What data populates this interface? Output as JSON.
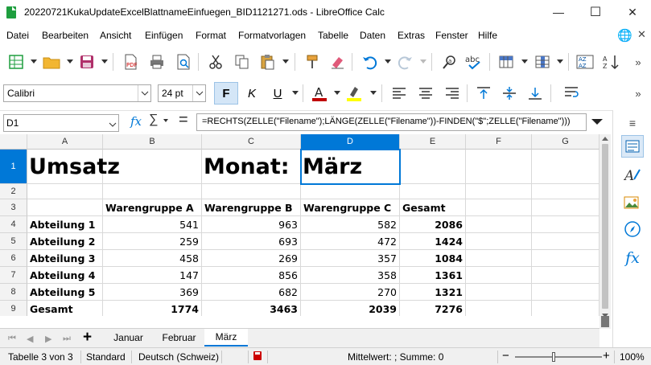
{
  "window": {
    "title": "20220721KukaUpdateExcelBlattnameEinfuegen_BID1121271.ods - LibreOffice Calc",
    "minimize": "—",
    "maximize": "☐",
    "close": "✕"
  },
  "menu": [
    "Datei",
    "Bearbeiten",
    "Ansicht",
    "Einfügen",
    "Format",
    "Formatvorlagen",
    "Tabelle",
    "Daten",
    "Extras",
    "Fenster",
    "Hilfe"
  ],
  "format_toolbar": {
    "font_name": "Calibri",
    "font_size": "24 pt",
    "bold": "F",
    "italic": "K",
    "underline": "U",
    "font_color": "#c00000",
    "highlight_color": "#ffff00"
  },
  "formula_bar": {
    "name_box": "D1",
    "fx": "fx",
    "sigma": "∑",
    "equals": "=",
    "formula": "=RECHTS(ZELLE(\"Filename\");LÄNGE(ZELLE(\"Filename\"))-FINDEN(\"$\";ZELLE(\"Filename\")))"
  },
  "grid": {
    "columns": [
      "A",
      "B",
      "C",
      "D",
      "E",
      "F",
      "G"
    ],
    "rows": [
      "1",
      "2",
      "3",
      "4",
      "5",
      "6",
      "7",
      "8",
      "9"
    ],
    "selected_col": "D",
    "selected_row": "1",
    "r1": {
      "a": "Umsatz",
      "c": "Monat:",
      "d": "März"
    },
    "headers": {
      "b": "Warengruppe A",
      "c": "Warengruppe B",
      "d": "Warengruppe C",
      "e": "Gesamt"
    },
    "data": [
      {
        "label": "Abteilung 1",
        "b": "541",
        "c": "963",
        "d": "582",
        "e": "2086"
      },
      {
        "label": "Abteilung 2",
        "b": "259",
        "c": "693",
        "d": "472",
        "e": "1424"
      },
      {
        "label": "Abteilung 3",
        "b": "458",
        "c": "269",
        "d": "357",
        "e": "1084"
      },
      {
        "label": "Abteilung 4",
        "b": "147",
        "c": "856",
        "d": "358",
        "e": "1361"
      },
      {
        "label": "Abteilung 5",
        "b": "369",
        "c": "682",
        "d": "270",
        "e": "1321"
      },
      {
        "label": "Gesamt",
        "b": "1774",
        "c": "3463",
        "d": "2039",
        "e": "7276"
      }
    ]
  },
  "tabs": {
    "add": "+",
    "sheets": [
      "Januar",
      "Februar",
      "März"
    ],
    "active": "März"
  },
  "statusbar": {
    "sheet": "Tabelle 3 von 3",
    "style": "Standard",
    "language": "Deutsch (Schweiz)",
    "summary": "Mittelwert: ; Summe: 0",
    "zoom_minus": "−",
    "zoom_plus": "+",
    "zoom": "100%"
  },
  "colors": {
    "accent": "#0078d7",
    "app_green": "#1e9e3e"
  }
}
